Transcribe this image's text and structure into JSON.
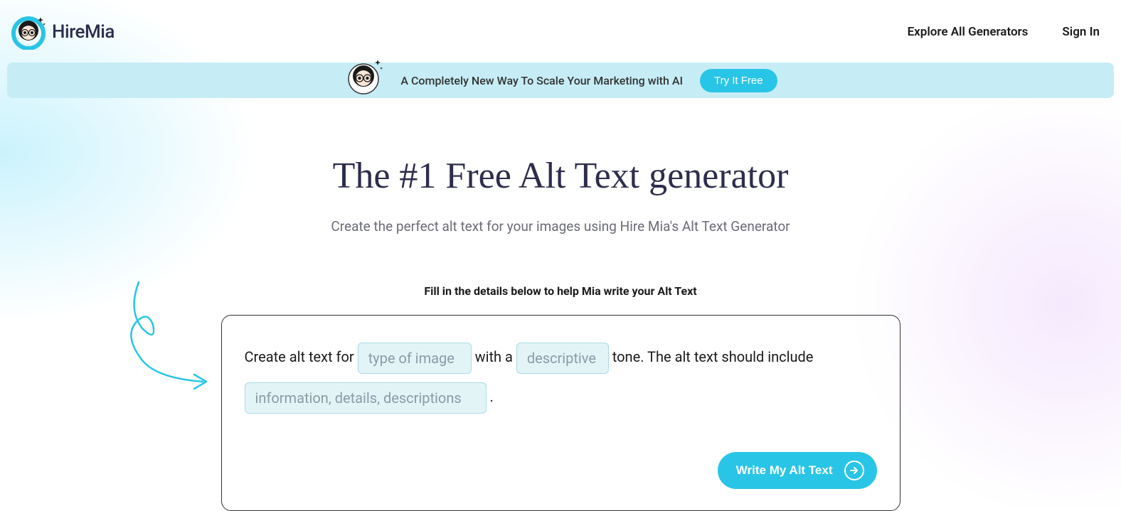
{
  "header": {
    "logo_text": "HireMia",
    "nav": {
      "explore": "Explore All Generators",
      "signin": "Sign In"
    }
  },
  "banner": {
    "text": "A Completely New Way To Scale Your Marketing with AI",
    "cta": "Try It Free"
  },
  "main": {
    "title": "The #1 Free Alt Text generator",
    "subtitle": "Create the perfect alt text for your images using Hire Mia's Alt Text Generator",
    "instruction": "Fill in the details below to help Mia write your Alt Text"
  },
  "form": {
    "part1": "Create alt text for ",
    "placeholder1": "type of image",
    "part2": " with a ",
    "placeholder2": "descriptive",
    "part3": " tone. The alt text should include ",
    "placeholder3": "information, details, descriptions",
    "part4": " .",
    "submit": "Write My Alt Text"
  }
}
